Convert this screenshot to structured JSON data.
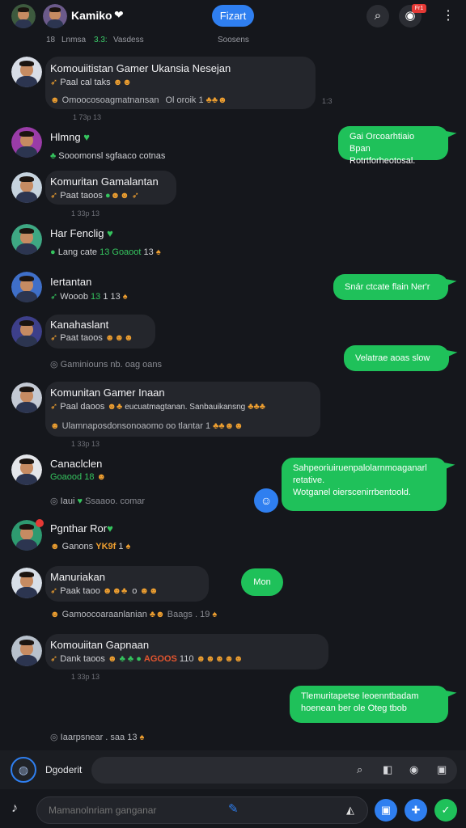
{
  "header": {
    "name": "Kamiko",
    "start_label": "Fizart",
    "notif_badge": "Fr1",
    "status_left": "18",
    "status_mid1": "Lnmsa",
    "status_green": "3.3:",
    "status_mid2": "Vasdess",
    "status_right": "Soosens"
  },
  "messages": [
    {
      "sender": "Komouiitistan Gamer Ukansia Nesejan",
      "line2": "Paal cal taks",
      "line3": "Omoocosoagmatnansan",
      "line3b": "Ol oroik  1",
      "time": "1 73p 13",
      "side_time": "1:3"
    },
    {
      "sender": "Hlmng",
      "line2": "Sooomonsl  sgfaaco cotnas"
    },
    {
      "sender": "Komuritan Gamalantan",
      "line2": "Paat taoos",
      "time": "1 33p 13"
    },
    {
      "sender": "Har Fenclig",
      "line2": "Lang cate",
      "line2_green": "13 Goaoot",
      "line2b": "13"
    },
    {
      "sender": "Iertantan",
      "line2": "Wooob",
      "line2_green": "13",
      "line2b": "1 13"
    },
    {
      "sender": "Kanahaslant",
      "line2": "Paat taoos",
      "line3": "Gaminiouns  nb. oag oans"
    },
    {
      "sender": "Komunitan Gamer Inaan",
      "line2": "Paal daoos",
      "line2_extra": "eucuatmagtanan. Sanbauikansng",
      "line3": "Ulamnaposdonsonoaomo oo tlantar  1",
      "time": "1 33p 13"
    },
    {
      "sender": "Canaclclen",
      "line2": "Goaood 18",
      "line3": "Iaui",
      "line3b": "Ssaaoo. comar"
    },
    {
      "sender": "Pgnthar Ror",
      "line2": "Ganons",
      "line2_orange": "YK9f",
      "line2b": "1"
    },
    {
      "sender": "Manuriakan",
      "line2": "Paak taoo",
      "line2b": "o",
      "line3": "Gamoocoaraanlanian",
      "line3b": "Baags . 19"
    },
    {
      "sender": "Komouiitan Gapnaan",
      "line2": "Dank taoos",
      "line2_orange": "AGOOS",
      "line2b": "110",
      "time": "1 33p 13"
    },
    {
      "line3": "Iaarpsnear . saa 13"
    }
  ],
  "outgoing": [
    {
      "l1": "Gai Orcoarhtiaio Bpan",
      "l2": "Rotrtforheotosal."
    },
    {
      "l1": "Snár ctcate flain Ner'r"
    },
    {
      "l1": "Velatrae aoas slow"
    },
    {
      "l1": "Sahpeoriuiruenpalolarnmoaganarl",
      "l2": "retative.",
      "l3": "Wotganel oierscenirrbentoold."
    },
    {
      "l1": "Mon"
    },
    {
      "l1": "Tlemuritapetse leoenntbadam",
      "l2": "hoenean ber ole Oteg tbob"
    }
  ],
  "composer": {
    "label": "Dgoderit",
    "placeholder": "Mamanolnriam ganganar"
  },
  "icons": {
    "search": "search-icon",
    "camera": "camera-icon",
    "menu": "kebab-menu-icon"
  },
  "colors": {
    "accent": "#2f7ff0",
    "outgoing_bubble": "#1fc15a",
    "background": "#15171c"
  }
}
